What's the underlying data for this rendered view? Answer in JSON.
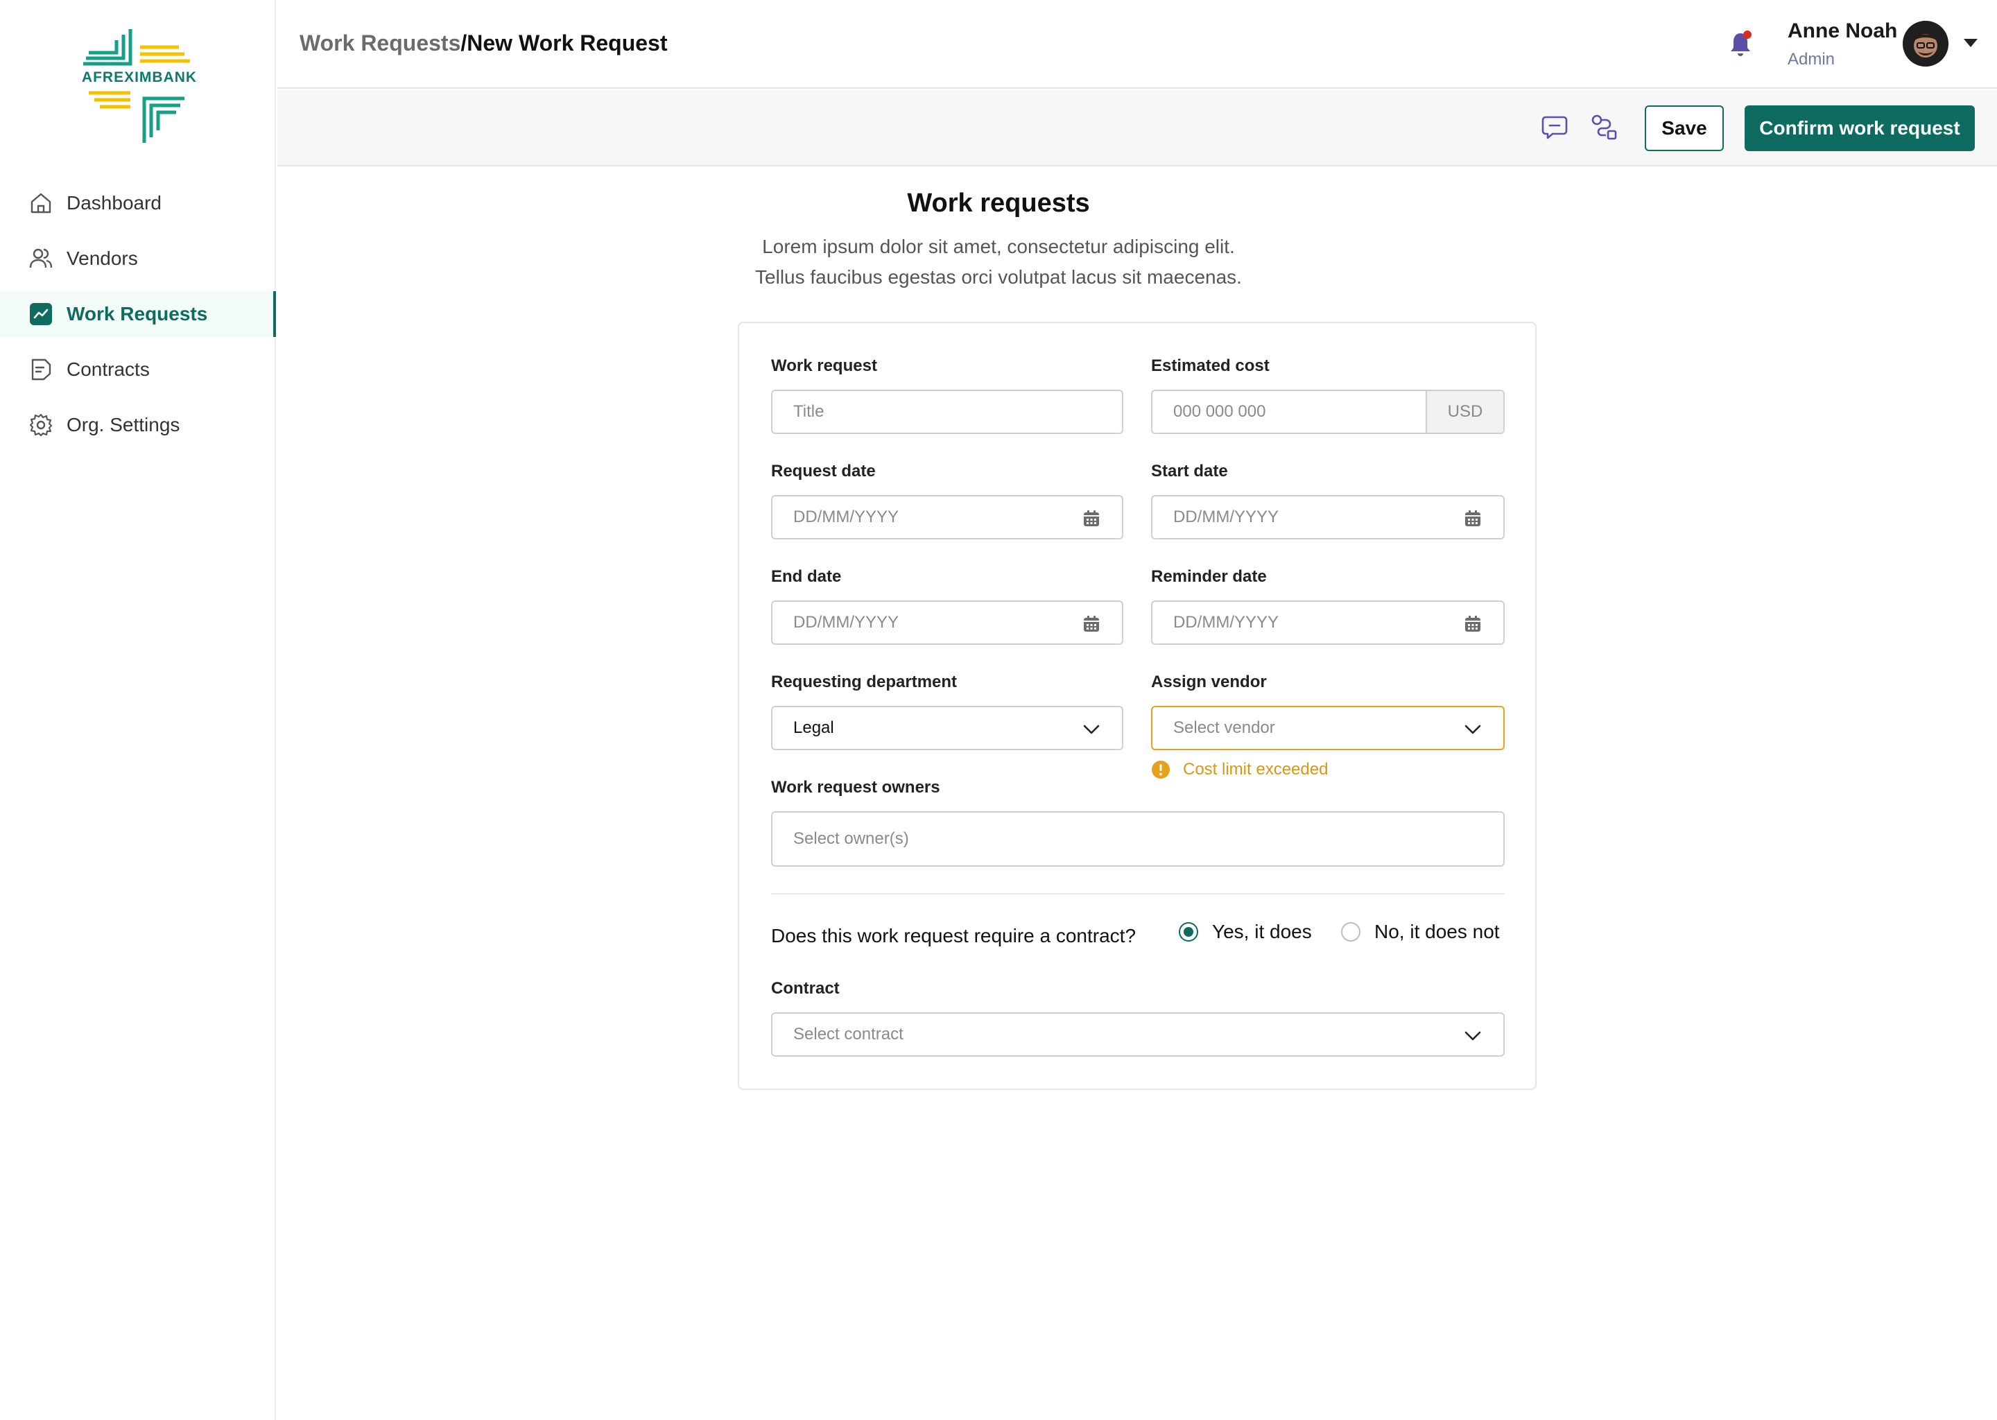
{
  "brand": {
    "name": "AFREXIMBANK"
  },
  "sidebar": {
    "items": [
      {
        "label": "Dashboard",
        "icon": "home-icon",
        "active": false
      },
      {
        "label": "Vendors",
        "icon": "users-icon",
        "active": false
      },
      {
        "label": "Work Requests",
        "icon": "chart-icon",
        "active": true
      },
      {
        "label": "Contracts",
        "icon": "document-icon",
        "active": false
      },
      {
        "label": "Org. Settings",
        "icon": "gear-icon",
        "active": false
      }
    ]
  },
  "header": {
    "breadcrumb": {
      "parent": "Work Requests",
      "separator": "/",
      "current": "New Work Request"
    },
    "user": {
      "name": "Anne Noah",
      "role": "Admin"
    }
  },
  "toolbar": {
    "save_label": "Save",
    "confirm_label": "Confirm work request"
  },
  "main": {
    "title": "Work requests",
    "description": "Lorem ipsum dolor sit amet, consectetur adipiscing elit. Tellus faucibus egestas orci volutpat lacus sit maecenas."
  },
  "form": {
    "work_request": {
      "label": "Work request",
      "placeholder": "Title"
    },
    "estimated_cost": {
      "label": "Estimated cost",
      "placeholder": "000 000 000",
      "currency": "USD"
    },
    "request_date": {
      "label": "Request date",
      "placeholder": "DD/MM/YYYY"
    },
    "start_date": {
      "label": "Start date",
      "placeholder": "DD/MM/YYYY"
    },
    "end_date": {
      "label": "End date",
      "placeholder": "DD/MM/YYYY"
    },
    "reminder_date": {
      "label": "Reminder date",
      "placeholder": "DD/MM/YYYY"
    },
    "department": {
      "label": "Requesting department",
      "value": "Legal"
    },
    "vendor": {
      "label": "Assign vendor",
      "placeholder": "Select vendor",
      "warning": "Cost limit exceeded"
    },
    "owners": {
      "label": "Work request owners",
      "placeholder": "Select owner(s)"
    },
    "contract_question": {
      "text": "Does this work request require a contract?",
      "yes": "Yes, it does",
      "no": "No, it does not",
      "selected": "yes"
    },
    "contract": {
      "label": "Contract",
      "placeholder": "Select contract"
    }
  },
  "colors": {
    "primary": "#0e6b60",
    "warning": "#e6a11f",
    "notification": "#d92d20"
  }
}
